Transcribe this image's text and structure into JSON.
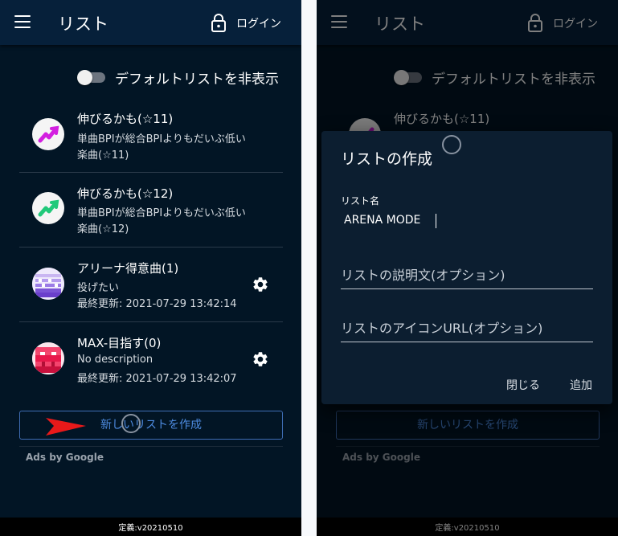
{
  "app": {
    "title": "リスト",
    "login_label": "ログイン"
  },
  "toggle": {
    "label": "デフォルトリストを非表示",
    "checked": false
  },
  "lists": [
    {
      "title": "伸びるかも(☆11)",
      "desc_line1": "単曲BPIが総合BPIよりもだいぶ低い",
      "desc_line2": "楽曲(☆11)",
      "avatar": "trend-up-purple-icon",
      "editable": false
    },
    {
      "title": "伸びるかも(☆12)",
      "desc_line1": "単曲BPIが総合BPIよりもだいぶ低い",
      "desc_line2": "楽曲(☆12)",
      "avatar": "trend-up-green-icon",
      "editable": false
    },
    {
      "title": "アリーナ得意曲(1)",
      "desc_line1": "投げたい",
      "desc_line2": "最終更新: 2021-07-29 13:42:14",
      "avatar": "purple-pixel-avatar",
      "editable": true
    },
    {
      "title": "MAX-目指す(0)",
      "desc_line1": "No description",
      "desc_line2": "最終更新: 2021-07-29 13:42:07",
      "avatar": "red-pixel-avatar",
      "editable": true
    }
  ],
  "create_button_label": "新しいリストを作成",
  "ads_label": "Ads by Google",
  "footer_text": "定義:v20210510",
  "dialog": {
    "title": "リストの作成",
    "name_label": "リスト名",
    "name_value": "ARENA MODE",
    "description_placeholder": "リストの説明文(オプション)",
    "icon_url_placeholder": "リストのアイコンURL(オプション)",
    "close_label": "閉じる",
    "add_label": "追加"
  },
  "colors": {
    "background": "#021525",
    "appbar": "#06203a",
    "accent": "#4d8be0",
    "arrow": "#e8191a"
  }
}
